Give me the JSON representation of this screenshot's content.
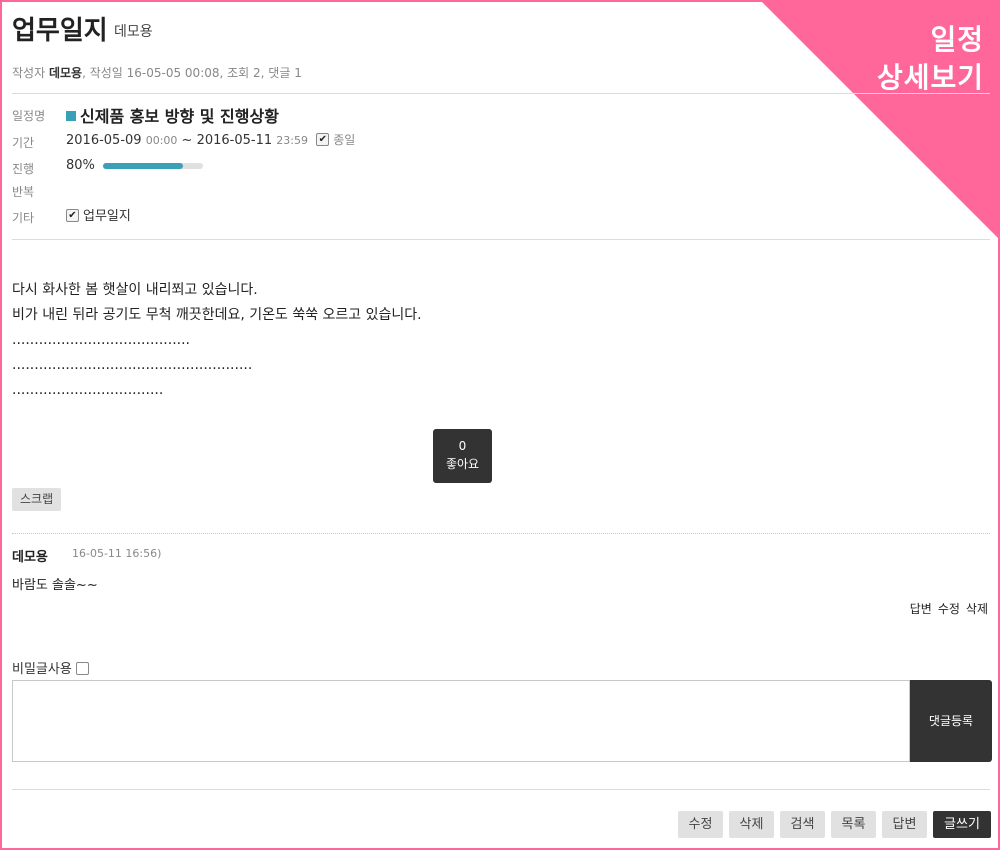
{
  "corner_badge": {
    "line1": "일정",
    "line2": "상세보기"
  },
  "header": {
    "title": "업무일지",
    "subtitle": "데모용"
  },
  "meta": {
    "author_label": "작성자",
    "author": "데모용",
    "rest": ", 작성일 16-05-05 00:08, 조회 2, 댓글 1"
  },
  "details": {
    "name_label": "일정명",
    "name": "신제품 홍보 방향 및 진행상황",
    "period_label": "기간",
    "start_date": "2016-05-09",
    "start_time": "00:00",
    "separator": "~",
    "end_date": "2016-05-11",
    "end_time": "23:59",
    "allday_label": "종일",
    "allday_checked": true,
    "progress_label": "진행",
    "progress_text": "80%",
    "progress_value": 0.8,
    "repeat_label": "반복",
    "etc_label": "기타",
    "etc_value": "업무일지",
    "etc_checked": true
  },
  "content": {
    "lines": [
      "다시 화사한 봄 햇살이 내리쬐고 있습니다.",
      "비가 내린 뒤라 공기도 무척 깨끗한데요, 기온도 쑥쑥 오르고 있습니다.",
      "........................................",
      "......................................................",
      ".................................."
    ]
  },
  "like": {
    "count": "0",
    "label": "좋아요"
  },
  "scrap_label": "스크랩",
  "comment": {
    "author": "데모용",
    "date": "16-05-11 16:56)",
    "text": "바람도 솔솔~~",
    "reply": "답변",
    "edit": "수정",
    "delete": "삭제"
  },
  "comment_form": {
    "secret_label": "비밀글사용",
    "submit_label": "댓글등록",
    "placeholder": ""
  },
  "bottom_buttons": {
    "edit": "수정",
    "delete": "삭제",
    "search": "검색",
    "list": "목록",
    "reply": "답변",
    "write": "글쓰기"
  },
  "colors": {
    "accent_pink": "#ff6699",
    "progress_teal": "#3aa0b8",
    "dark_button": "#333333"
  }
}
